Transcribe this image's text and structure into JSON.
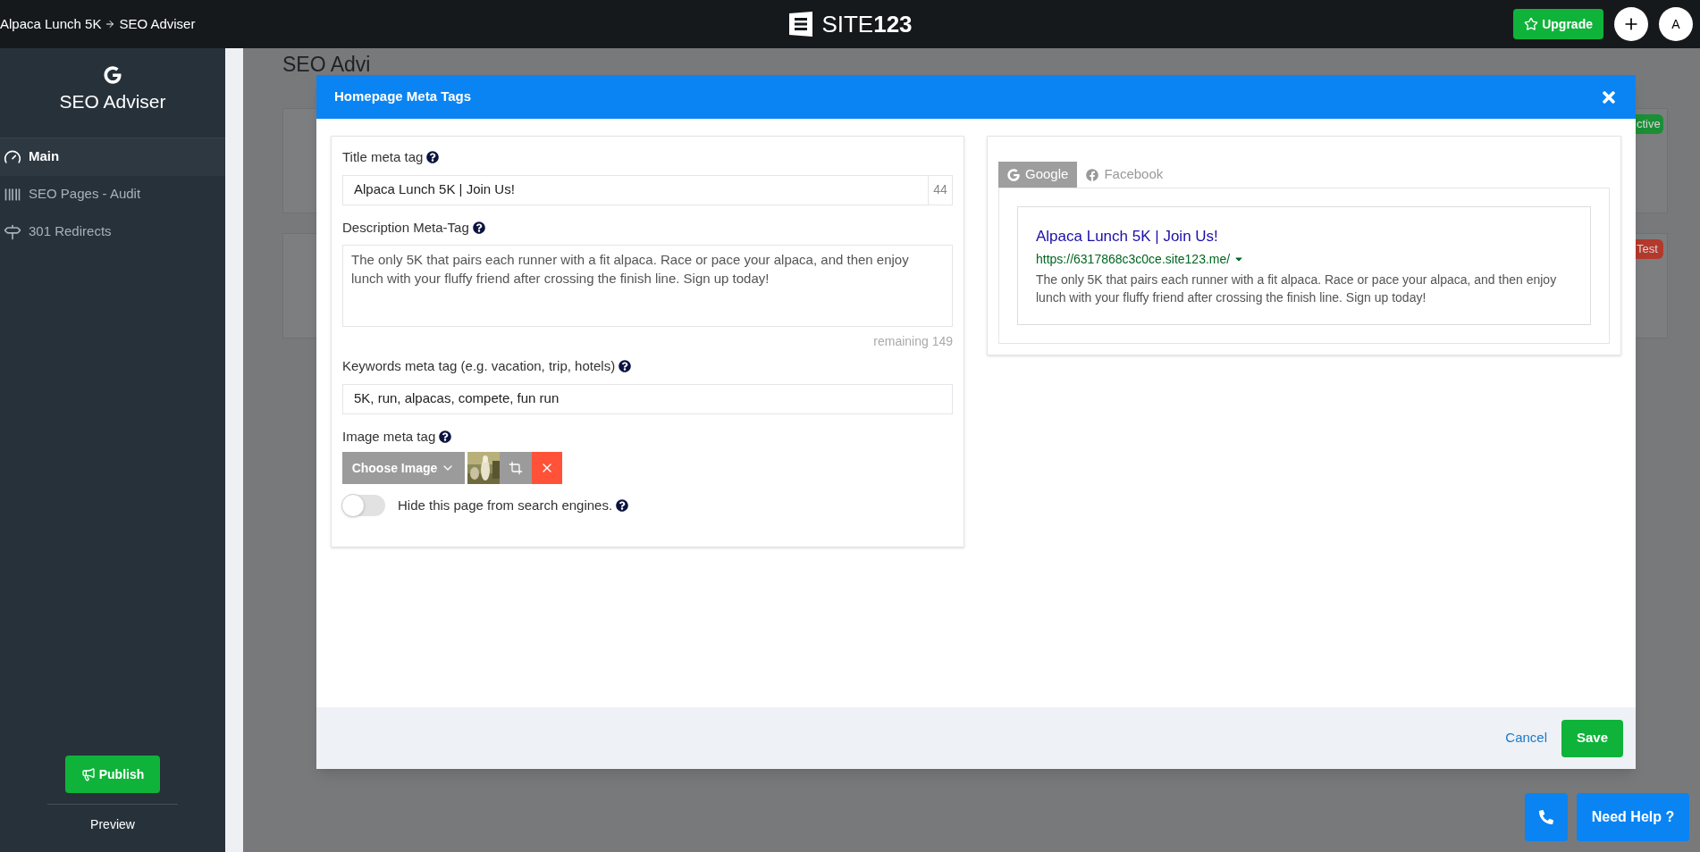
{
  "topbar": {
    "breadcrumb": [
      "Alpaca Lunch 5K",
      "SEO Adviser"
    ],
    "logo_text": "SITE",
    "logo_number": "123",
    "upgrade_button": "Upgrade",
    "avatar": "A"
  },
  "sidebar": {
    "title": "SEO Adviser",
    "items": [
      {
        "label": "Main",
        "selected": true
      },
      {
        "label": "SEO Pages - Audit",
        "selected": false
      },
      {
        "label": "301 Redirects",
        "selected": false
      }
    ],
    "publish_button": "Publish",
    "preview_link": "Preview"
  },
  "background_page": {
    "title": "SEO Advi",
    "badges": [
      {
        "label": "ctive",
        "color": "#1a8f36"
      },
      {
        "label": "Test",
        "color": "#b3392c"
      }
    ]
  },
  "modal": {
    "title": "Homepage Meta Tags",
    "title_field": {
      "label": "Title meta tag",
      "value": "Alpaca Lunch 5K | Join Us!",
      "count": "44"
    },
    "description_field": {
      "label": "Description Meta-Tag",
      "value": "The only 5K that pairs each runner with a fit alpaca. Race or pace your alpaca, and then enjoy lunch with your fluffy friend after crossing the finish line. Sign up today!",
      "remaining": "remaining 149"
    },
    "keywords_field": {
      "label": "Keywords meta tag (e.g. vacation, trip, hotels)",
      "value": "5K, run, alpacas, compete, fun run"
    },
    "image_field": {
      "label": "Image meta tag",
      "choose_button": "Choose Image"
    },
    "hide_toggle": {
      "label": "Hide this page from search engines.",
      "on": false
    },
    "preview_tabs": [
      {
        "label": "Google",
        "selected": true
      },
      {
        "label": "Facebook",
        "selected": false
      }
    ],
    "google_preview": {
      "title": "Alpaca Lunch 5K | Join Us!",
      "url": "https://6317868c3c0ce.site123.me/",
      "description": "The only 5K that pairs each runner with a fit alpaca. Race or pace your alpaca, and then enjoy lunch with your fluffy friend after crossing the finish line. Sign up today!"
    },
    "cancel_button": "Cancel",
    "save_button": "Save"
  },
  "help_button": "Need Help ?"
}
